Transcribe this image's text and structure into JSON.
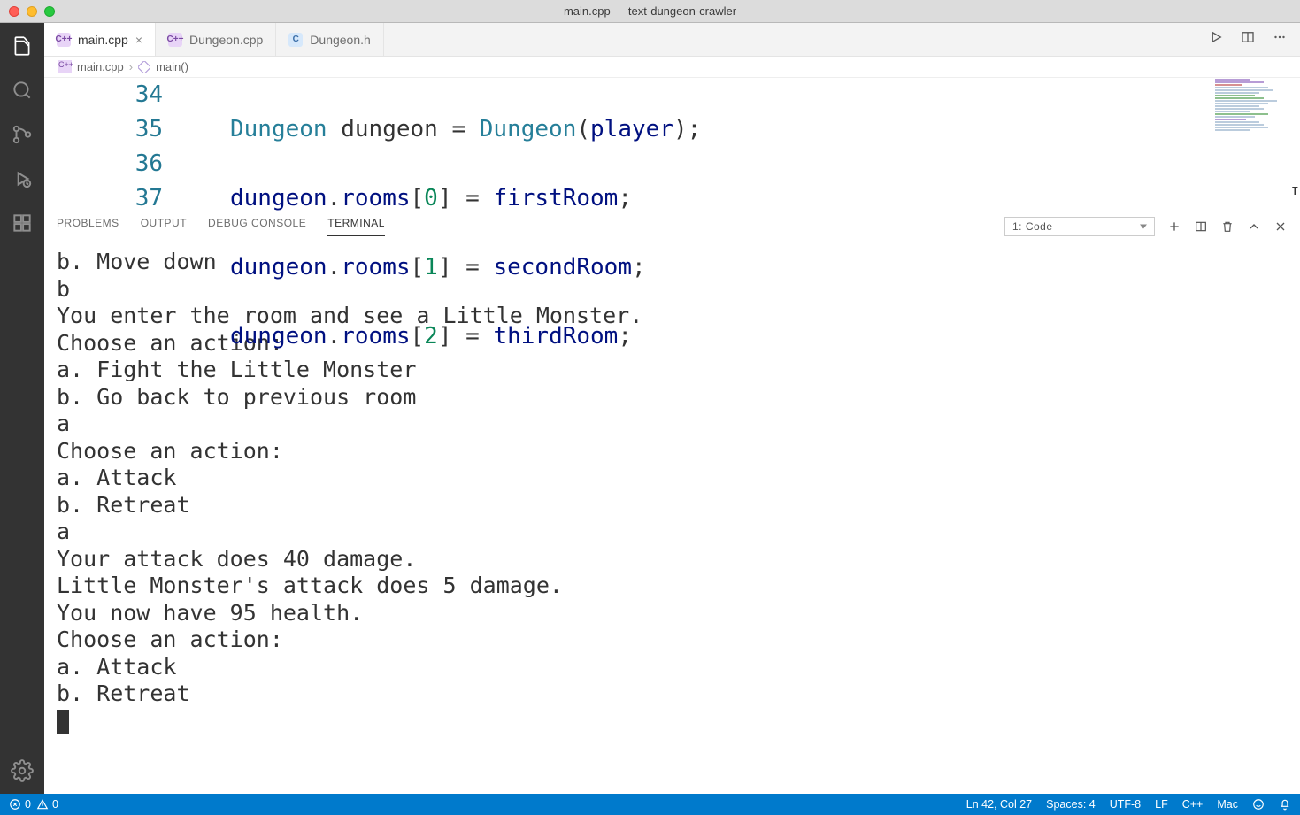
{
  "window": {
    "title": "main.cpp — text-dungeon-crawler"
  },
  "tabs": [
    {
      "label": "main.cpp",
      "icon": "C++",
      "active": true,
      "close": "×"
    },
    {
      "label": "Dungeon.cpp",
      "icon": "C++",
      "active": false
    },
    {
      "label": "Dungeon.h",
      "icon": "C",
      "active": false
    }
  ],
  "breadcrumb": {
    "file_icon": "C++",
    "file": "main.cpp",
    "sep": "›",
    "symbol": "main()"
  },
  "code": {
    "lines": [
      {
        "num": "34",
        "tokens": [
          "Dungeon",
          " dungeon ",
          "=",
          " ",
          "Dungeon",
          "(",
          "player",
          ")",
          ";"
        ]
      },
      {
        "num": "35",
        "tokens_plain": "dungeon.rooms[0] = firstRoom;"
      },
      {
        "num": "36",
        "tokens_plain": "dungeon.rooms[1] = secondRoom;"
      },
      {
        "num": "37",
        "tokens_plain": "dungeon.rooms[2] = thirdRoom;"
      }
    ]
  },
  "panel": {
    "tabs": [
      "PROBLEMS",
      "OUTPUT",
      "DEBUG CONSOLE",
      "TERMINAL"
    ],
    "active_index": 3,
    "terminal_selector": "1: Code"
  },
  "terminal_output": "b. Move down\nb\nYou enter the room and see a Little Monster.\nChoose an action:\na. Fight the Little Monster\nb. Go back to previous room\na\nChoose an action:\na. Attack\nb. Retreat\na\nYour attack does 40 damage.\nLittle Monster's attack does 5 damage.\nYou now have 95 health.\nChoose an action:\na. Attack\nb. Retreat",
  "statusbar": {
    "errors": "0",
    "warnings": "0",
    "cursor": "Ln 42, Col 27",
    "spaces": "Spaces: 4",
    "encoding": "UTF-8",
    "eol": "LF",
    "lang": "C++",
    "os": "Mac"
  }
}
